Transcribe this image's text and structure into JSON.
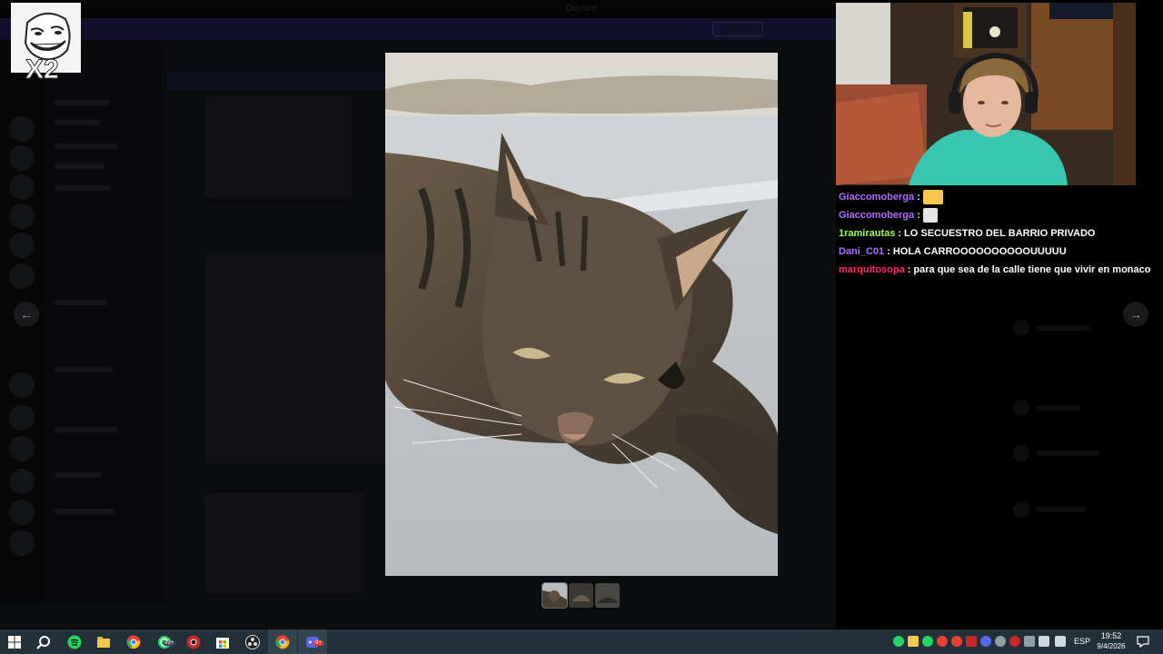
{
  "window": {
    "title": "Discord",
    "banner_text": "",
    "banner_button": ""
  },
  "logo": {
    "badge": "X2"
  },
  "viewer": {
    "prev_icon": "arrow-left-icon",
    "next_icon": "arrow-right-icon",
    "thumbnails_count": 3,
    "active_thumbnail": 1
  },
  "chat": {
    "messages": [
      {
        "user": "Giaccomoberga",
        "color": "#b26bff",
        "text": "",
        "emote": "laughing-emote"
      },
      {
        "user": "Giaccomoberga",
        "color": "#b26bff",
        "text": "",
        "emote": "troll-face-emote"
      },
      {
        "user": "1ramirautas",
        "color": "#9aff4c",
        "text": "LO SECUESTRO DEL BARRIO PRIVADO"
      },
      {
        "user": "Dani_C01",
        "color": "#b26bff",
        "text": "HOLA CARROOOOOOOOOOUUUUU"
      },
      {
        "user": "marquitosopa",
        "color": "#ff2a6a",
        "text": "para que sea de la calle tiene que vivir en monaco"
      }
    ]
  },
  "taskbar": {
    "icons": [
      "windows-start-icon",
      "search-icon",
      "spotify-icon",
      "file-explorer-icon",
      "chrome-icon",
      "whatsapp-icon",
      "chrome-red-icon",
      "microsoft-store-icon",
      "obs-icon",
      "chrome-profile-icon",
      "discord-icon"
    ],
    "whatsapp_badge": "99+",
    "discord_badge": "9+",
    "language": "ESP",
    "time": "19:52",
    "date": "9/4/2026"
  },
  "colors": {
    "taskbar": "#22303a",
    "overlay": "#000000",
    "chat_purple": "#b26bff",
    "chat_green": "#9aff4c",
    "chat_red": "#ff2a6a"
  }
}
